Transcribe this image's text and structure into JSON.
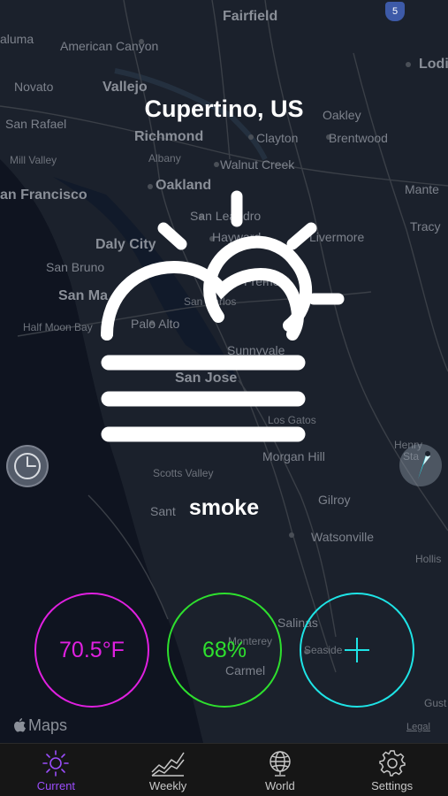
{
  "location": "Cupertino, US",
  "condition": "smoke",
  "weather_icon": "sun-behind-cloud-fog-icon",
  "metrics": {
    "temperature": "70.5°F",
    "humidity": "68%",
    "add_symbol": "+"
  },
  "colors": {
    "temperature": "#e020e0",
    "humidity": "#2ee02e",
    "add": "#1ee4e6",
    "active_tab": "#9b4dfb"
  },
  "map": {
    "brand": "Maps",
    "legal": "Legal",
    "places": {
      "fairfield": "Fairfield",
      "aluma": "aluma",
      "american_canyon": "American Canyon",
      "lodi": "Lodi",
      "novato": "Novato",
      "vallejo": "Vallejo",
      "oakley": "Oakley",
      "san_rafael": "San Rafael",
      "richmond": "Richmond",
      "clayton": "Clayton",
      "brentwood": "Brentwood",
      "mill_valley": "Mill Valley",
      "albany": "Albany",
      "walnut_creek": "Walnut Creek",
      "san_francisco": "an Francisco",
      "oakland": "Oakland",
      "manteca": "Mante",
      "san_leandro": "San Leandro",
      "tracy": "Tracy",
      "daly_city": "Daly City",
      "hayward": "Hayward",
      "livermore": "Livermore",
      "san_bruno": "San Bruno",
      "fremont": "Fremont",
      "san_mateo": "San Ma",
      "san_carlos": "San Carlos",
      "half_moon_bay": "Half Moon Bay",
      "palo_alto": "Palo Alto",
      "sunnyvale": "Sunnyvale",
      "san_jose": "San Jose",
      "los_gatos": "Los Gatos",
      "morgan_hill": "Morgan Hill",
      "henry_coe": "Henry",
      "henry_coe_2": "Sta",
      "scotts_valley": "Scotts Valley",
      "santa_cruz": "Sant",
      "gilroy": "Gilroy",
      "watsonville": "Watsonville",
      "hollister": "Hollis",
      "salinas": "Salinas",
      "monterey": "Monterey",
      "carmel": "Carmel",
      "seaside": "Seaside",
      "gust": "Gust",
      "highway_shield": "5"
    }
  },
  "tabs": [
    {
      "label": "Current",
      "icon": "sun-icon",
      "active": true
    },
    {
      "label": "Weekly",
      "icon": "trend-chart-icon",
      "active": false
    },
    {
      "label": "World",
      "icon": "globe-icon",
      "active": false
    },
    {
      "label": "Settings",
      "icon": "gear-icon",
      "active": false
    }
  ]
}
